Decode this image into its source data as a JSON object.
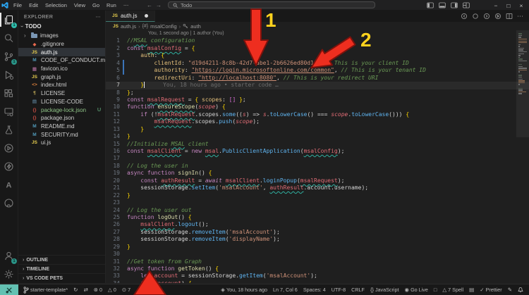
{
  "titlebar": {
    "menus": [
      "File",
      "Edit",
      "Selection",
      "View",
      "Go",
      "Run",
      "⋯"
    ],
    "search_placeholder": "Todo"
  },
  "activity_bar": {
    "items": [
      "explorer",
      "search",
      "source-control",
      "run-debug",
      "extensions",
      "remote-explorer",
      "testing",
      "play-circle",
      "thunder-client",
      "azure",
      "github",
      "accounts",
      "settings"
    ],
    "badges": {
      "explorer": "1",
      "source_control": "1",
      "accounts": "1"
    }
  },
  "sidebar": {
    "title": "EXPLORER",
    "root_folder": "TODO",
    "files": [
      {
        "label": "images",
        "icon": "folder-icon"
      },
      {
        "label": ".gitignore",
        "icon": "git-file-icon"
      },
      {
        "label": "auth.js",
        "icon": "js-file-icon",
        "selected": true
      },
      {
        "label": "CODE_OF_CONDUCT.md",
        "icon": "markdown-file-icon"
      },
      {
        "label": "favicon.ico",
        "icon": "image-file-icon"
      },
      {
        "label": "graph.js",
        "icon": "js-file-icon"
      },
      {
        "label": "index.html",
        "icon": "html-file-icon"
      },
      {
        "label": "LICENSE",
        "icon": "license-file-icon"
      },
      {
        "label": "LICENSE-CODE",
        "icon": "text-file-icon"
      },
      {
        "label": "package-lock.json",
        "icon": "npm-file-icon",
        "badge": "U"
      },
      {
        "label": "package.json",
        "icon": "npm-file-icon"
      },
      {
        "label": "README.md",
        "icon": "markdown-file-icon"
      },
      {
        "label": "SECURITY.md",
        "icon": "markdown-file-icon"
      },
      {
        "label": "ui.js",
        "icon": "js-file-icon"
      }
    ],
    "sections": [
      "OUTLINE",
      "TIMELINE",
      "VS CODE PETS"
    ]
  },
  "editor": {
    "tab": {
      "icon": "js-badge",
      "label": "auth.js",
      "modified": true
    },
    "breadcrumb": [
      {
        "icon": "js-badge",
        "label": "auth.js"
      },
      {
        "icon": "symbol-object",
        "label": "msalConfig"
      },
      {
        "icon": "key",
        "label": "auth"
      }
    ],
    "codelens": "You, 1 second ago | 1 author (You)",
    "current_line": 7,
    "cursor_position": "Ln 7, Col 6",
    "blame_text": "You, 18 hours ago • starter code …",
    "modified_gutter_lines": [
      4,
      5
    ],
    "code_lines": [
      "//MSAL configuration",
      "const msalConfig = {",
      "    auth: {",
      "        clientId: \"d19d4211-8c8b-42d7-abe1-2b6626ed80d1\", // This is your client ID",
      "        authority: \"https://login.microsoftonline.com/common\", // This is your tenant ID",
      "        redirectUri: \"http://localhost:8080\", // This is your redirect URI",
      "    }",
      "};",
      "const msalRequest = { scopes: [] };",
      "function ensureScope(scope) {",
      "    if (!msalRequest.scopes.some((s) => s.toLowerCase() === scope.toLowerCase())) {",
      "        msalRequest.scopes.push(scope);",
      "    }",
      "}",
      "//Initialize MSAL client",
      "const msalClient = new msal.PublicClientApplication(msalConfig);",
      "",
      "// Log the user in",
      "async function signIn() {",
      "    const authResult = await msalClient.loginPopup(msalRequest);",
      "    sessionStorage.setItem('msalAccount', authResult.account.username);",
      "}",
      "",
      "// Log the user out",
      "function logOut() {",
      "    msalClient.logout();",
      "    sessionStorage.removeItem('msalAccount');",
      "    sessionStorage.removeItem('displayName');",
      "}",
      "",
      "//Get token from Graph",
      "async function getToken() {",
      "    let account = sessionStorage.getItem('msalAccount');",
      "    if (!account) {"
    ]
  },
  "status_bar": {
    "left": [
      {
        "icon": "git-branch-icon",
        "label": "starter-template*"
      },
      {
        "icon": "sync-icon",
        "label": ""
      },
      {
        "icon": "layers-icon",
        "label": ""
      },
      {
        "icon": "errors-icon",
        "label": "0"
      },
      {
        "icon": "warnings-icon",
        "label": "0"
      },
      {
        "icon": "info-icon",
        "label": "7"
      }
    ],
    "right": [
      {
        "icon": "commit-icon",
        "label": "You, 18 hours ago"
      },
      {
        "icon": "",
        "label": "Ln 7, Col 6"
      },
      {
        "icon": "",
        "label": "Spaces: 4"
      },
      {
        "icon": "",
        "label": "UTF-8"
      },
      {
        "icon": "",
        "label": "CRLF"
      },
      {
        "icon": "braces-icon",
        "label": "JavaScript"
      },
      {
        "icon": "broadcast-icon",
        "label": "Go Live"
      },
      {
        "icon": "box-icon",
        "label": ""
      },
      {
        "icon": "warning-icon",
        "label": "7 Spell"
      },
      {
        "icon": "preview-icon",
        "label": ""
      },
      {
        "icon": "check-icon",
        "label": "Prettier"
      },
      {
        "icon": "pencil-icon",
        "label": ""
      },
      {
        "icon": "bell-icon",
        "label": ""
      }
    ]
  },
  "annotations": {
    "arrow_labels": [
      "1",
      "2"
    ],
    "colors": {
      "arrow_red": "#ee2e1f",
      "arrow_outline": "#7e120c",
      "label_yellow": "#ffd21e"
    }
  },
  "colors": {
    "badge_teal": "#2fbcab",
    "remote_chip": "#63c1b2",
    "tab_active_border": "#3f7a72"
  }
}
